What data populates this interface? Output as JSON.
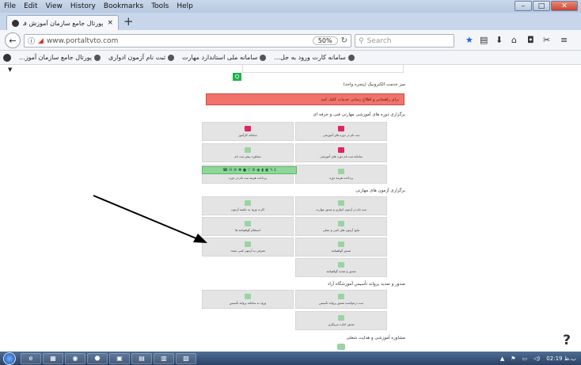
{
  "menubar": {
    "items": [
      "File",
      "Edit",
      "View",
      "History",
      "Bookmarks",
      "Tools",
      "Help"
    ],
    "win": {
      "min": "–",
      "max": "□",
      "close": "✕"
    }
  },
  "tab": {
    "title": "پورتال جامع سازمان آموزش فنی و ...",
    "close": "×",
    "new": "+"
  },
  "nav": {
    "url": "www.portaltvto.com",
    "zoom": "50%",
    "search_placeholder": "Search"
  },
  "bookmarks": [
    "سامانه کارت ورود به جل...",
    "سامانه ملی استاندارد مهارت",
    "ثبت نام آزمون ادواری",
    "پورتال جامع سازمان آموز..."
  ],
  "content": {
    "sec_ekec": "میز خدمت الکترونیک (پنجره واحد)",
    "alert": "برای راهنمایی و اطلاع رسانی خدمات کلیک کنید",
    "sec_courses": "برگزاری دوره های آموزشی مهارتی فنی و حرفه ای ",
    "courses": [
      {
        "label": "ثبت نام در دوره های آموزشی",
        "icon": "pen-icon",
        "color": "#e0245e"
      },
      {
        "label": "سامانه کارآموز",
        "icon": "id-card-icon",
        "color": "#e0245e"
      },
      {
        "label": "سامانه ثبت نام دوره های آموزشی",
        "icon": "pen-icon",
        "color": "#e0245e"
      },
      {
        "label": "مشاوره پیش ثبت نام",
        "icon": "doc-icon",
        "color": "#9bd3a4"
      },
      {
        "label": "پرداخت هزینه دوره",
        "icon": "card-icon",
        "color": "#9bd3a4"
      },
      {
        "label": "پرداخت هزینه ثبت نام در دوره",
        "icon": "card-icon",
        "color": "#9bd3a4"
      }
    ],
    "sec_exams": "برگزاری آزمون های مهارتی",
    "exams": [
      {
        "label": "ثبت نام در آزمون ادواری و صدور مهارت",
        "icon": "user-icon",
        "color": "#9bd3a4"
      },
      {
        "label": "کارت ورود به جلسه آزمون",
        "icon": "card-icon",
        "color": "#9bd3a4"
      },
      {
        "label": "نتایج آزمون های کتبی و عملی",
        "icon": "user-icon",
        "color": "#9bd3a4"
      },
      {
        "label": "استعلام گواهینامه ها",
        "icon": "hand-icon",
        "color": "#9bd3a4"
      },
      {
        "label": "صدور گواهینامه",
        "icon": "cert-icon",
        "color": "#9bd3a4"
      },
      {
        "label": "معرفی به آزمون کتبی مجدد",
        "icon": "doc-icon",
        "color": "#9bd3a4"
      },
      {
        "label": "صدور و تمدید گواهینامه",
        "icon": "card-icon",
        "color": "#9bd3a4"
      }
    ],
    "sec_license": "صدور و تمدید پروانه تأسیس آموزشگاه آزاد",
    "license": [
      {
        "label": "ثبت درخواست صدور پروانه تأسیس",
        "icon": "building-icon",
        "color": "#9bd3a4"
      },
      {
        "label": "ورود به سامانه پروانه تأسیس",
        "icon": "building-icon",
        "color": "#9bd3a4"
      },
      {
        "label": "صدور اجازه مربیگری",
        "icon": "badge-icon",
        "color": "#9bd3a4"
      }
    ],
    "sec_counsel": "مشاوره آموزشی و هدایت شغلی ",
    "toolbar_icons": "☎ ✉ ⚙ ✱ ● ▽ ⚙ ◉ ▮ ▣ ✎ ℹ"
  },
  "taskbar": {
    "time": "02:19 ب.ظ",
    "apps": [
      "e",
      "▦",
      "◉",
      "⬣",
      "▣",
      "▤",
      "▥",
      "▧"
    ]
  },
  "help": "?"
}
